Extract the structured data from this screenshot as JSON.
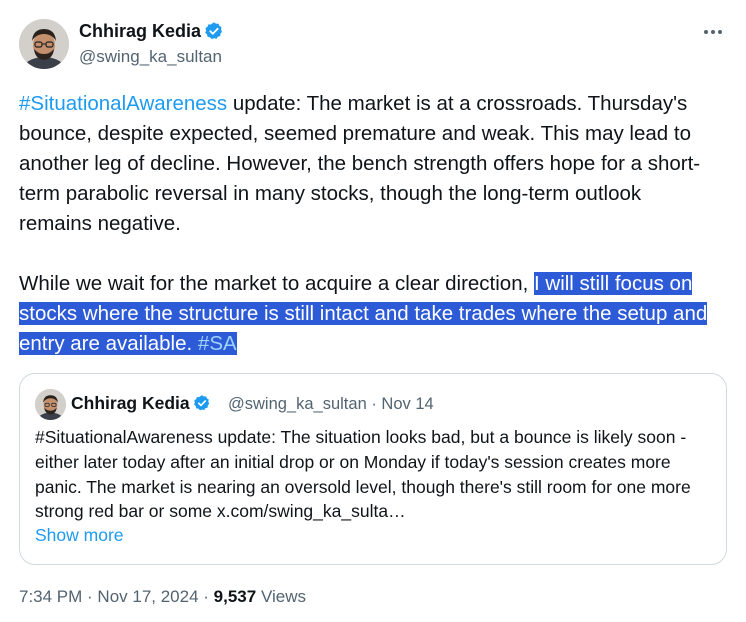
{
  "author": {
    "name": "Chhirag Kedia",
    "handle": "@swing_ka_sultan",
    "verified": true
  },
  "tweet": {
    "hashtag_lead": "#SituationalAwareness",
    "para1_rest": " update: The market is at a crossroads. Thursday's bounce, despite expected, seemed premature and weak. This may lead to another leg of decline. However, the bench strength offers hope for a short-term parabolic reversal in many stocks, though the long-term outlook remains negative.",
    "para2_plain": "While we wait for the market to acquire a clear direction, ",
    "para2_selected": "I will still focus on stocks where the structure is still intact and take trades where the setup and entry are available.",
    "para2_space": " ",
    "hashtag_end": "#SA"
  },
  "quote": {
    "name": "Chhirag Kedia",
    "meta": "@swing_ka_sultan · Nov 14",
    "text": "#SituationalAwareness update: The situation looks bad, but a bounce is likely soon - either later today after an initial drop or on Monday if today's session creates more panic. The market is nearing an oversold level, though there's still room for one more strong red bar or some x.com/swing_ka_sulta…",
    "show_more": "Show more"
  },
  "footer": {
    "time": "7:34 PM",
    "sep1": " · ",
    "date": "Nov 17, 2024",
    "sep2": " · ",
    "views_count": "9,537",
    "views_label": " Views"
  },
  "icons": {
    "more": "more-options-icon",
    "verified": "verified-badge-icon"
  },
  "colors": {
    "accent": "#1d9bf0",
    "selection": "#2d5bd7",
    "muted": "#536471",
    "text": "#0f1419",
    "border": "#cfd9de"
  }
}
